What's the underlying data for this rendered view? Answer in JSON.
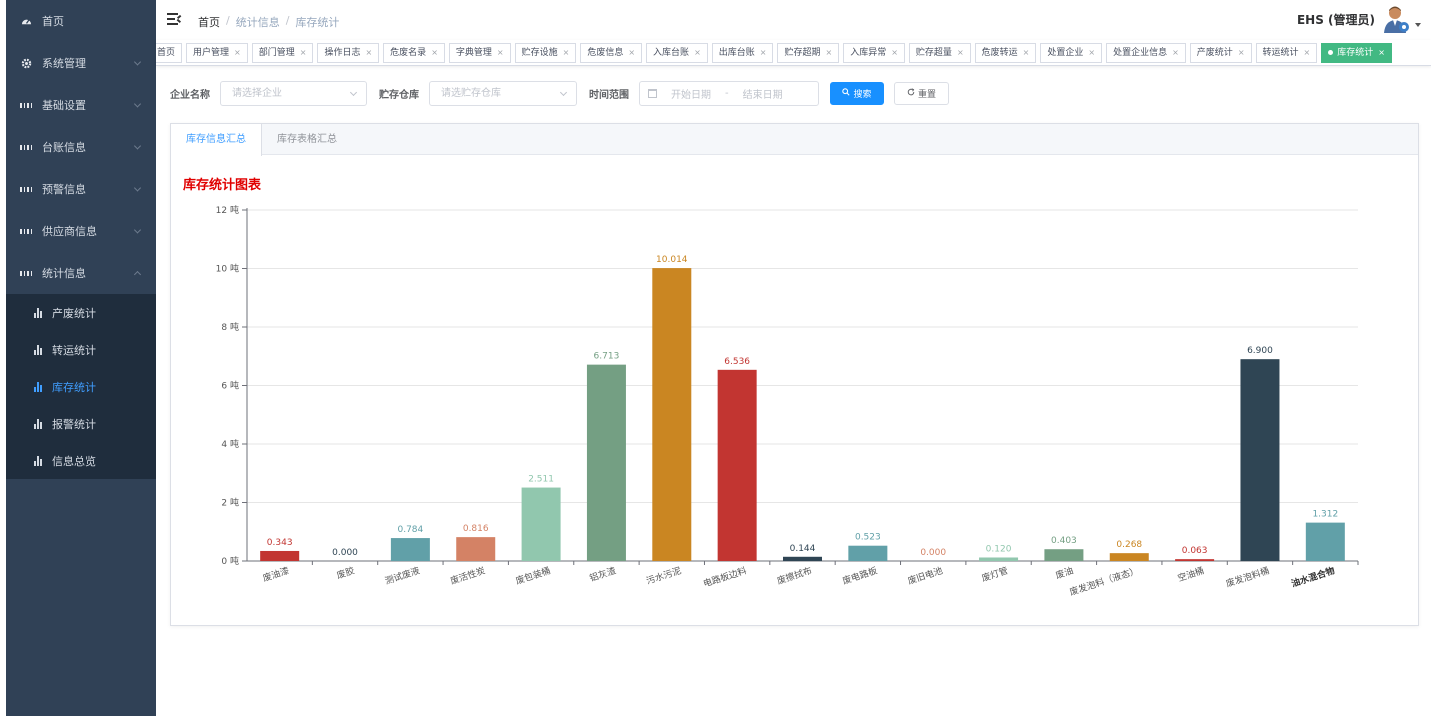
{
  "sidebar": {
    "items": [
      {
        "label": "首页",
        "icon": "dashboard-icon",
        "chevron": false
      },
      {
        "label": "系统管理",
        "icon": "gear-icon",
        "chevron": true
      },
      {
        "label": "基础设置",
        "icon": "grid-icon",
        "chevron": true
      },
      {
        "label": "台账信息",
        "icon": "grid-icon",
        "chevron": true
      },
      {
        "label": "预警信息",
        "icon": "grid-icon",
        "chevron": true
      },
      {
        "label": "供应商信息",
        "icon": "grid-icon",
        "chevron": true
      },
      {
        "label": "统计信息",
        "icon": "grid-icon",
        "chevron": true,
        "expanded": true
      }
    ],
    "subitems": [
      {
        "label": "产废统计",
        "active": false
      },
      {
        "label": "转运统计",
        "active": false
      },
      {
        "label": "库存统计",
        "active": true
      },
      {
        "label": "报警统计",
        "active": false
      },
      {
        "label": "信息总览",
        "active": false
      }
    ]
  },
  "header": {
    "breadcrumb": [
      "首页",
      "统计信息",
      "库存统计"
    ],
    "separator": "/",
    "user": "EHS (管理员)"
  },
  "tags": [
    {
      "label": "首页",
      "closable": false
    },
    {
      "label": "用户管理",
      "closable": true
    },
    {
      "label": "部门管理",
      "closable": true
    },
    {
      "label": "操作日志",
      "closable": true
    },
    {
      "label": "危废名录",
      "closable": true
    },
    {
      "label": "字典管理",
      "closable": true
    },
    {
      "label": "贮存设施",
      "closable": true
    },
    {
      "label": "危废信息",
      "closable": true
    },
    {
      "label": "入库台账",
      "closable": true
    },
    {
      "label": "出库台账",
      "closable": true
    },
    {
      "label": "贮存超期",
      "closable": true
    },
    {
      "label": "入库异常",
      "closable": true
    },
    {
      "label": "贮存超量",
      "closable": true
    },
    {
      "label": "危废转运",
      "closable": true
    },
    {
      "label": "处置企业",
      "closable": true
    },
    {
      "label": "处置企业信息",
      "closable": true
    },
    {
      "label": "产废统计",
      "closable": true
    },
    {
      "label": "转运统计",
      "closable": true
    },
    {
      "label": "库存统计",
      "closable": true,
      "active": true
    }
  ],
  "tag_close": "×",
  "filter": {
    "company_label": "企业名称",
    "company_placeholder": "请选择企业",
    "warehouse_label": "贮存仓库",
    "warehouse_placeholder": "请选贮存仓库",
    "time_label": "时间范围",
    "start_placeholder": "开始日期",
    "range_sep": "-",
    "end_placeholder": "结束日期",
    "search_label": "搜索",
    "reset_label": "重置"
  },
  "tabs": [
    {
      "label": "库存信息汇总",
      "active": true
    },
    {
      "label": "库存表格汇总",
      "active": false
    }
  ],
  "chart_title": "库存统计图表",
  "chart_data": {
    "type": "bar",
    "categories": [
      "废油漆",
      "废胶",
      "测试废液",
      "废活性炭",
      "废包装桶",
      "铝灰渣",
      "污水污泥",
      "电路板边料",
      "废擦拭布",
      "废电路板",
      "废旧电池",
      "废灯管",
      "废油",
      "废发泡料（液态）",
      "空油桶",
      "废发泡料桶",
      "油水混合物"
    ],
    "values": [
      0.343,
      0.0,
      0.784,
      0.816,
      2.511,
      6.713,
      10.014,
      6.536,
      0.144,
      0.523,
      0.0,
      0.12,
      0.403,
      0.268,
      0.063,
      6.9,
      1.312
    ],
    "value_labels": [
      "0.343",
      "0.000",
      "0.784",
      "0.816",
      "2.511",
      "6.713",
      "10.014",
      "6.536",
      "0.144",
      "0.523",
      "0.000",
      "0.120",
      "0.403",
      "0.268",
      "0.063",
      "6.900",
      "1.312"
    ],
    "colors": [
      "#c23531",
      "#2f4554",
      "#61a0a8",
      "#d48265",
      "#91c7ae",
      "#749f83",
      "#ca8622",
      "#c23531",
      "#2f4554",
      "#61a0a8",
      "#d48265",
      "#91c7ae",
      "#749f83",
      "#ca8622",
      "#c23531",
      "#2f4554",
      "#61a0a8"
    ],
    "yticks": [
      "0 吨",
      "2 吨",
      "4 吨",
      "6 吨",
      "8 吨",
      "10 吨",
      "12 吨"
    ],
    "ylim": [
      0,
      12
    ],
    "grid": true
  }
}
